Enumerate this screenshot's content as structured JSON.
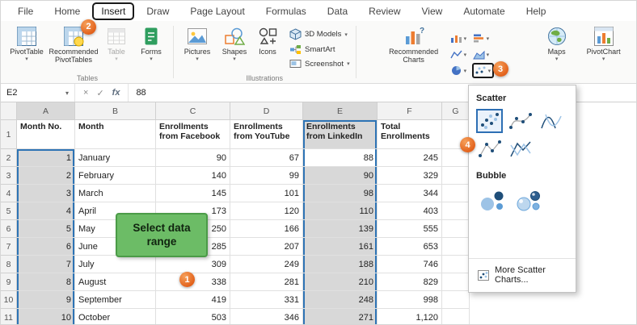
{
  "tabs": {
    "items": [
      "File",
      "Home",
      "Insert",
      "Draw",
      "Page Layout",
      "Formulas",
      "Data",
      "Review",
      "View",
      "Automate",
      "Help"
    ],
    "selected": "Insert"
  },
  "ribbon": {
    "tables": {
      "group_label": "Tables",
      "pivottable": "PivotTable",
      "recommended_pivottables": "Recommended PivotTables",
      "table": "Table",
      "forms": "Forms"
    },
    "illustrations": {
      "group_label": "Illustrations",
      "pictures": "Pictures",
      "shapes": "Shapes",
      "icons": "Icons",
      "models_3d": "3D Models",
      "smartart": "SmartArt",
      "screenshot": "Screenshot"
    },
    "charts": {
      "recommended_charts": "Recommended Charts",
      "maps": "Maps",
      "pivotchart": "PivotChart",
      "mini_chart_icons": [
        "column-chart-icon",
        "bar-chart-icon",
        "line-chart-icon",
        "area-chart-icon",
        "pie-chart-icon",
        "scatter-chart-icon"
      ]
    }
  },
  "formula_bar": {
    "name_box": "E2",
    "cancel_icon": "×",
    "enter_icon": "✓",
    "fx_label": "fx",
    "value": "88"
  },
  "spreadsheet": {
    "column_letters": [
      "A",
      "B",
      "C",
      "D",
      "E",
      "F",
      "G"
    ],
    "header_row": [
      "Month No.",
      "Month",
      "Enrollments from Facebook",
      "Enrollments from YouTube",
      "Enrollments from LinkedIn",
      "Total Enrollments"
    ],
    "rows": [
      [
        "1",
        "January",
        "90",
        "67",
        "88",
        "245"
      ],
      [
        "2",
        "February",
        "140",
        "99",
        "90",
        "329"
      ],
      [
        "3",
        "March",
        "145",
        "101",
        "98",
        "344"
      ],
      [
        "4",
        "April",
        "173",
        "120",
        "110",
        "403"
      ],
      [
        "5",
        "May",
        "250",
        "166",
        "139",
        "555"
      ],
      [
        "6",
        "June",
        "285",
        "207",
        "161",
        "653"
      ],
      [
        "7",
        "July",
        "309",
        "249",
        "188",
        "746"
      ],
      [
        "8",
        "August",
        "338",
        "281",
        "210",
        "829"
      ],
      [
        "9",
        "September",
        "419",
        "331",
        "248",
        "998"
      ],
      [
        "10",
        "October",
        "503",
        "346",
        "271",
        "1,120"
      ]
    ],
    "selection": {
      "ranges": [
        {
          "col": 0,
          "first_row": 2,
          "last_row": 11
        },
        {
          "col": 4,
          "first_row": 1,
          "last_row": 11
        }
      ],
      "active_cell": {
        "col": 4,
        "row": 2
      }
    }
  },
  "chart_menu": {
    "scatter_label": "Scatter",
    "bubble_label": "Bubble",
    "more_label": "More Scatter Charts...",
    "scatter_options": [
      "scatter",
      "scatter-with-smooth-lines-and-markers",
      "scatter-with-smooth-lines",
      "scatter-with-straight-lines-and-markers",
      "scatter-with-straight-lines"
    ],
    "bubble_options": [
      "bubble",
      "3d-bubble"
    ]
  },
  "annotations": {
    "badge1": "1",
    "badge2": "2",
    "badge3": "3",
    "badge4": "4",
    "callout_text": "Select data range"
  }
}
